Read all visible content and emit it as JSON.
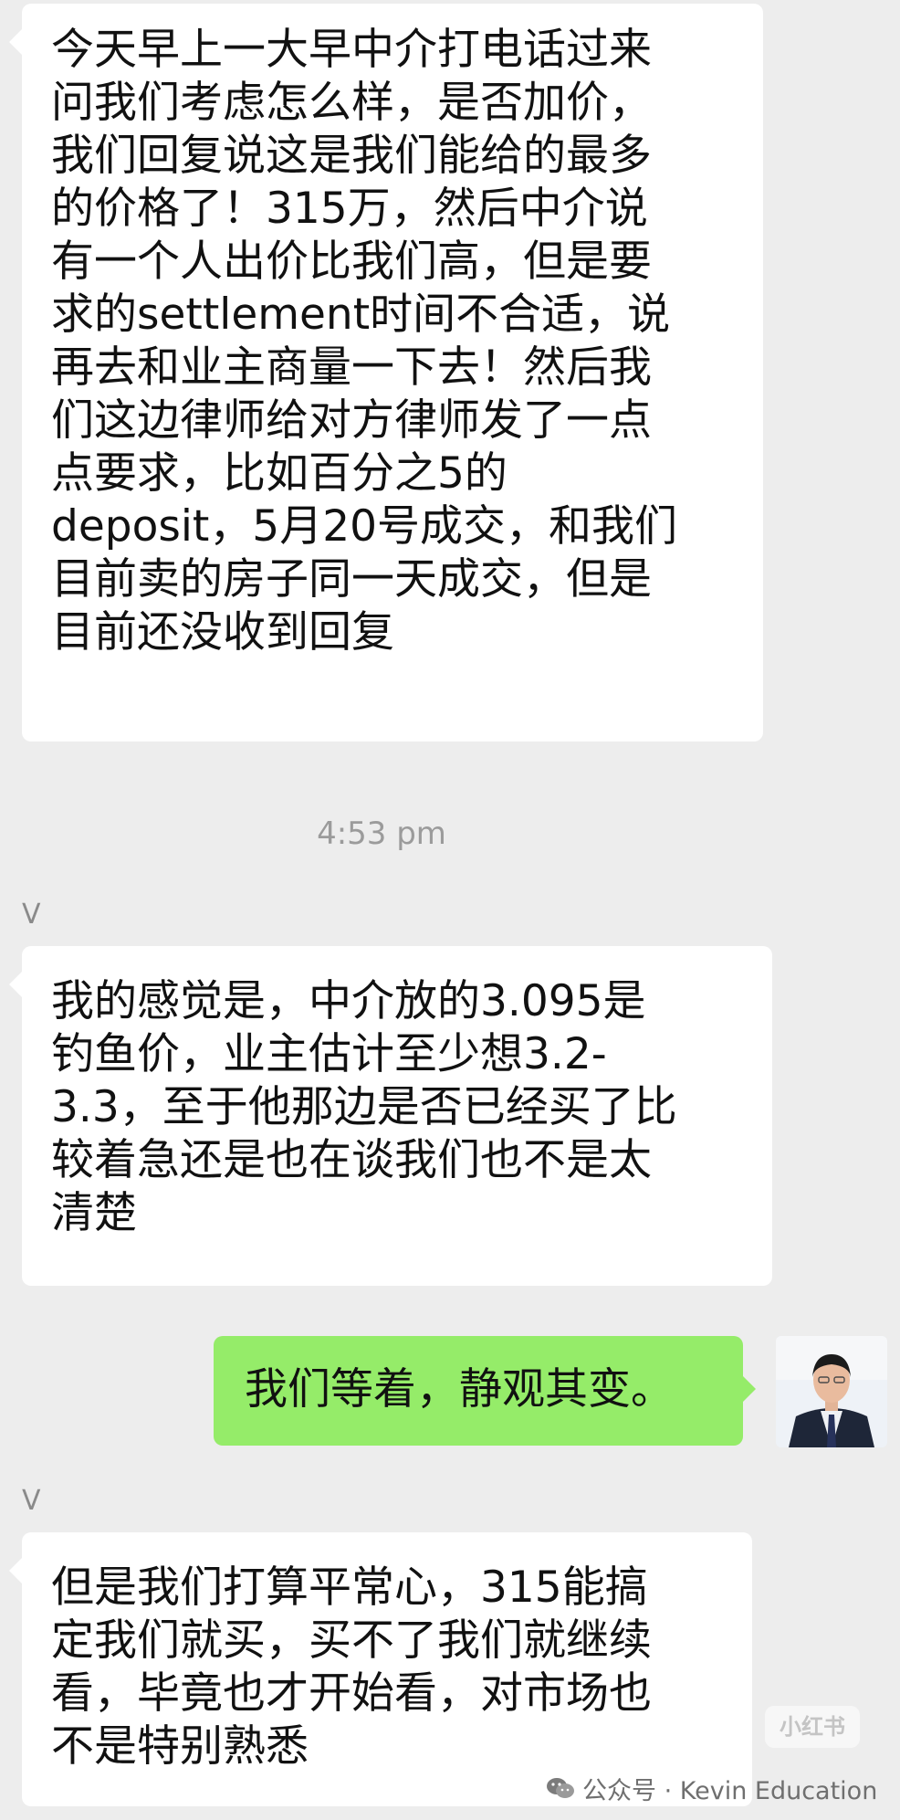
{
  "messages": [
    {
      "text": "今天早上一大早中介打电话过来\n问我们考虑怎么样，是否加价，\n我们回复说这是我们能给的最多\n的价格了！315万，然后中介说\n有一个人出价比我们高，但是要\n求的settlement时间不合适，说\n再去和业主商量一下去！然后我\n们这边律师给对方律师发了一点\n点要求，比如百分之5的\ndeposit，5月20号成交，和我们\n目前卖的房子同一天成交，但是\n目前还没收到回复"
    },
    {
      "timestamp": "4:53 pm"
    },
    {
      "sender": "V",
      "text": "我的感觉是，中介放的3.095是\n钓鱼价，业主估计至少想3.2-\n3.3，至于他那边是否已经买了比\n较着急还是也在谈我们也不是太\n清楚"
    },
    {
      "text": "我们等着，静观其变。"
    },
    {
      "sender": "V",
      "text": "但是我们打算平常心，315能搞\n定我们就买，买不了我们就继续\n看，毕竟也才开始看，对市场也\n不是特别熟悉"
    }
  ],
  "watermark": {
    "badge": "小红书",
    "footer": "公众号 · Kevin Education"
  },
  "colors": {
    "background": "#ededed",
    "incoming_bubble": "#ffffff",
    "outgoing_bubble": "#95ec69"
  }
}
